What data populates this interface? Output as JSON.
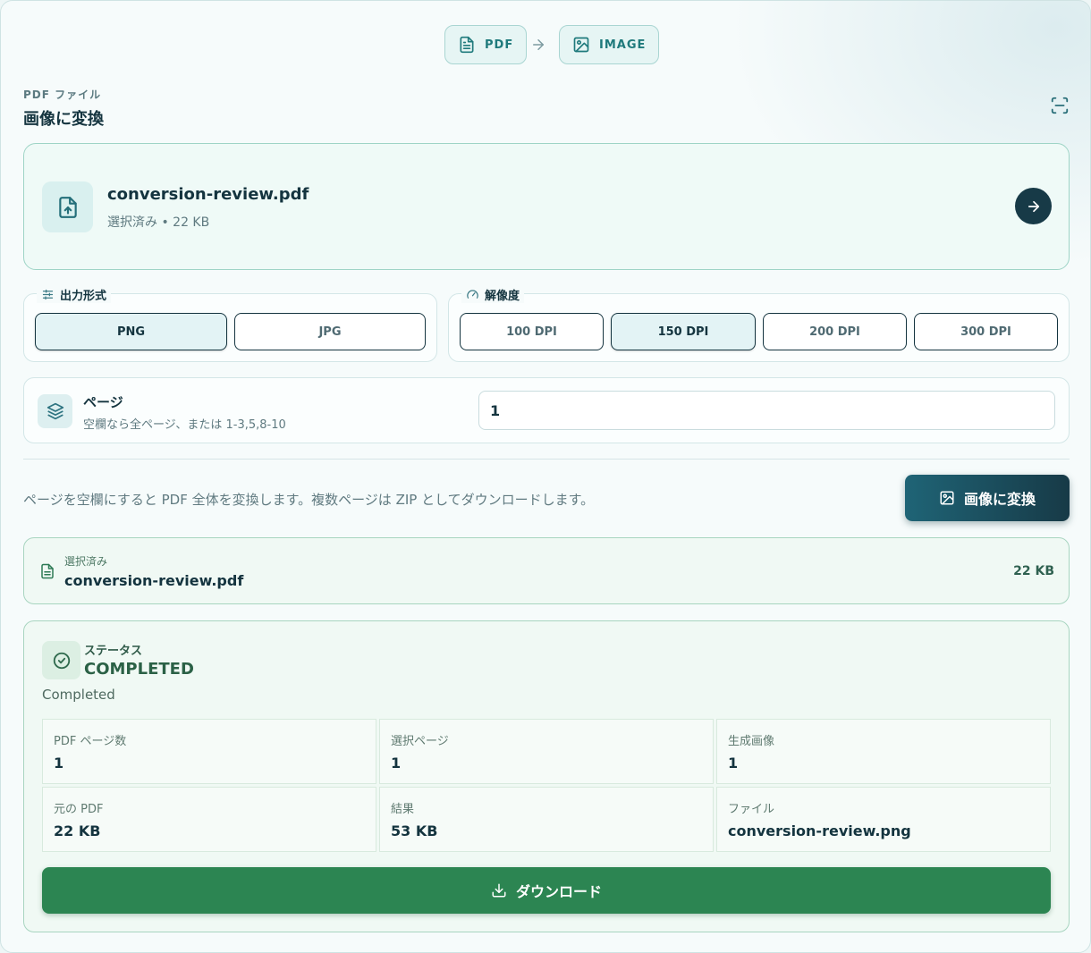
{
  "header": {
    "from_label": "PDF",
    "to_label": "IMAGE",
    "eyebrow": "PDF ファイル",
    "title": "画像に変換"
  },
  "file": {
    "name": "conversion-review.pdf",
    "meta": "選択済み • 22 KB"
  },
  "output_format": {
    "legend": "出力形式",
    "options": [
      "PNG",
      "JPG"
    ],
    "selected": "PNG"
  },
  "resolution": {
    "legend": "解像度",
    "options": [
      "100 DPI",
      "150 DPI",
      "200 DPI",
      "300 DPI"
    ],
    "selected": "150 DPI"
  },
  "pages": {
    "label": "ページ",
    "hint": "空欄なら全ページ、または 1-3,5,8-10",
    "value": "1"
  },
  "note": "ページを空欄にすると PDF 全体を変換します。複数ページは ZIP としてダウンロードします。",
  "convert_button": "画像に変換",
  "selected_file": {
    "label": "選択済み",
    "name": "conversion-review.pdf",
    "size": "22 KB"
  },
  "status": {
    "label": "ステータス",
    "value": "COMPLETED",
    "sub": "Completed",
    "cells": [
      {
        "label": "PDF ページ数",
        "value": "1"
      },
      {
        "label": "選択ページ",
        "value": "1"
      },
      {
        "label": "生成画像",
        "value": "1"
      },
      {
        "label": "元の PDF",
        "value": "22 KB"
      },
      {
        "label": "結果",
        "value": "53 KB"
      },
      {
        "label": "ファイル",
        "value": "conversion-review.png"
      }
    ]
  },
  "download_button": "ダウンロード",
  "colors": {
    "accent": "#1f7a7c",
    "dark": "#173a47",
    "success": "#2c8552"
  }
}
